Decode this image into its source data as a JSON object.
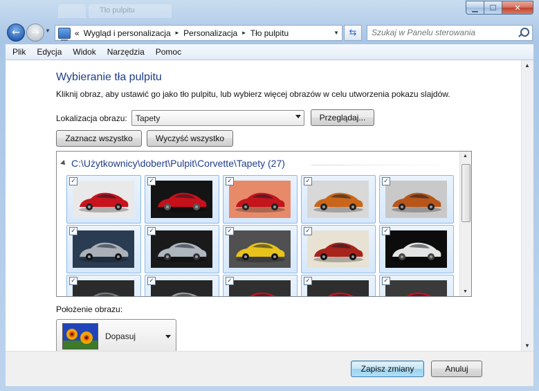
{
  "window": {
    "ghost_title": "Tło pulpitu"
  },
  "address": {
    "recent_glyph": "«",
    "crumbs": [
      "Wygląd i personalizacja",
      "Personalizacja",
      "Tło pulpitu"
    ],
    "sep": "▸"
  },
  "search": {
    "placeholder": "Szukaj w Panelu sterowania"
  },
  "menu": [
    "Plik",
    "Edycja",
    "Widok",
    "Narzędzia",
    "Pomoc"
  ],
  "page": {
    "title": "Wybieranie tła pulpitu",
    "subtitle": "Kliknij obraz, aby ustawić go jako tło pulpitu, lub wybierz więcej obrazów w celu utworzenia pokazu slajdów."
  },
  "location": {
    "label": "Lokalizacja obrazu:",
    "value": "Tapety",
    "browse_label": "Przeglądaj..."
  },
  "selection": {
    "select_all": "Zaznacz wszystko",
    "clear_all": "Wyczyść wszystko"
  },
  "gallery": {
    "group_title": "C:\\Użytkownicy\\dobert\\Pulpit\\Corvette\\Tapety (27)",
    "check_glyph": "✓",
    "tiles": [
      {
        "bg": "#e9e9e9",
        "car": "#c8141e",
        "wheel": "#222"
      },
      {
        "bg": "#141414",
        "car": "#c6101a",
        "wheel": "#555"
      },
      {
        "bg": "#e68a6a",
        "car": "#c4141c",
        "wheel": "#222"
      },
      {
        "bg": "#d8d8d8",
        "car": "#c9661a",
        "wheel": "#222"
      },
      {
        "bg": "#c9c9c9",
        "car": "#b8561a",
        "wheel": "#222"
      },
      {
        "bg": "#2a3c52",
        "car": "#a9b0b8",
        "wheel": "#111"
      },
      {
        "bg": "#1a1a1a",
        "car": "#aeb6be",
        "wheel": "#333"
      },
      {
        "bg": "#505050",
        "car": "#e8c31a",
        "wheel": "#111"
      },
      {
        "bg": "#e8e2d4",
        "car": "#a8231b",
        "wheel": "#111"
      },
      {
        "bg": "#0c0c0c",
        "car": "#e4e4e4",
        "wheel": "#444"
      },
      {
        "bg": "#2b2b2b",
        "car": "#777",
        "wheel": "#111"
      },
      {
        "bg": "#262626",
        "car": "#999",
        "wheel": "#111"
      },
      {
        "bg": "#303030",
        "car": "#c5121c",
        "wheel": "#111"
      },
      {
        "bg": "#2e2e2e",
        "car": "#c5121c",
        "wheel": "#111"
      },
      {
        "bg": "#3a3a3a",
        "car": "#c5121c",
        "wheel": "#111"
      }
    ]
  },
  "position": {
    "label": "Położenie obrazu:",
    "value": "Dopasuj"
  },
  "footer": {
    "save_label": "Zapisz zmiany",
    "cancel_label": "Anuluj"
  }
}
